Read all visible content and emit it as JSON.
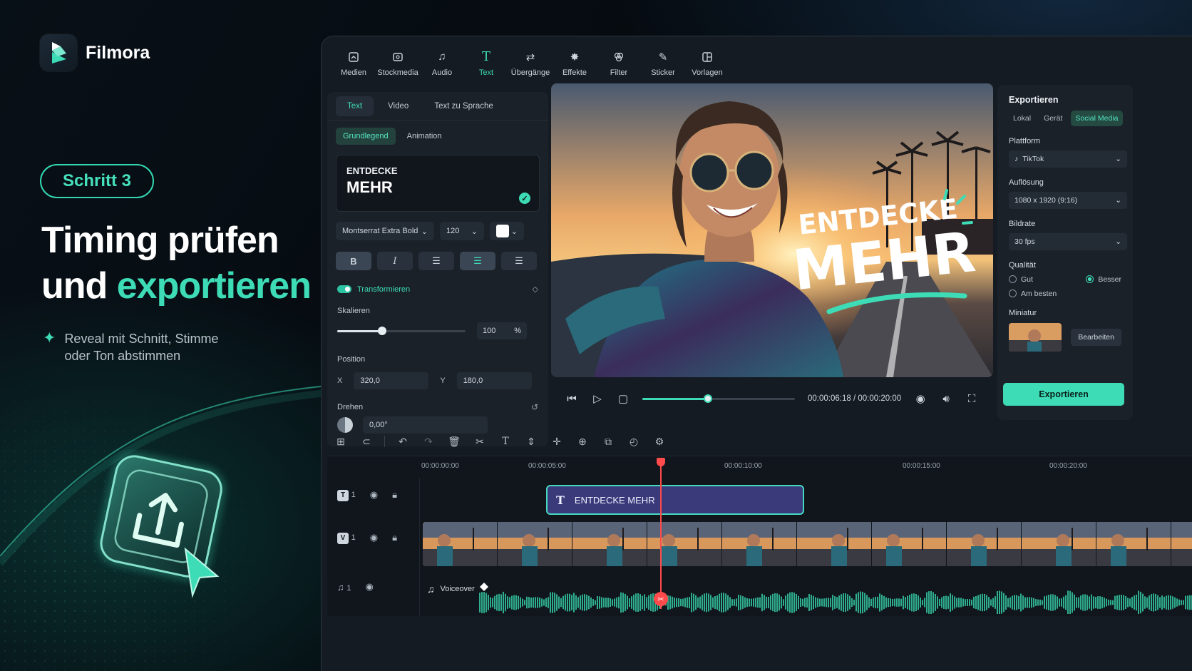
{
  "brand": {
    "name": "Filmora"
  },
  "step_badge": "Schritt 3",
  "headline": {
    "line1": "Timing prüfen",
    "line2_pre": "und ",
    "line2_accent": "exportieren"
  },
  "subtext": {
    "line1": "Reveal mit Schnitt, Stimme",
    "line2": "oder Ton abstimmen"
  },
  "toolbar": {
    "items": [
      {
        "label": "Medien",
        "icon": "media-icon"
      },
      {
        "label": "Stockmedia",
        "icon": "stock-media-icon"
      },
      {
        "label": "Audio",
        "icon": "music-note-icon"
      },
      {
        "label": "Text",
        "icon": "text-icon",
        "active": true
      },
      {
        "label": "Übergänge",
        "icon": "transitions-icon"
      },
      {
        "label": "Effekte",
        "icon": "effects-icon"
      },
      {
        "label": "Filter",
        "icon": "filter-icon"
      },
      {
        "label": "Sticker",
        "icon": "sticker-icon"
      },
      {
        "label": "Vorlagen",
        "icon": "templates-icon"
      }
    ]
  },
  "text_panel": {
    "tabs": [
      "Text",
      "Video",
      "Text zu Sprache"
    ],
    "subtabs": [
      "Grundlegend",
      "Animation"
    ],
    "content_line1": "ENTDECKE",
    "content_line2": "MEHR",
    "font": "Montserrat Extra Bold",
    "size": "120",
    "color": "#ffffff",
    "transform_label": "Transformieren",
    "scale_label": "Skalieren",
    "scale_value": "100",
    "scale_unit": "%",
    "scale_fraction": 0.35,
    "position_label": "Position",
    "x_label": "X",
    "x_value": "320,0",
    "y_label": "Y",
    "y_value": "180,0",
    "rotate_label": "Drehen",
    "rotate_value": "0,00°"
  },
  "preview": {
    "overlay_line1": "ENTDECKE",
    "overlay_line2": "MEHR",
    "progress_fraction": 0.43,
    "current_time": "00:00:06:18",
    "separator": "/",
    "total_time": "00:00:20:00"
  },
  "export_panel": {
    "title": "Exportieren",
    "tabs": [
      "Lokal",
      "Gerät",
      "Social Media"
    ],
    "platform_label": "Plattform",
    "platform_value": "TikTok",
    "resolution_label": "Auflösung",
    "resolution_value": "1080 x 1920 (9:16)",
    "framerate_label": "Bildrate",
    "framerate_value": "30 fps",
    "quality_label": "Qualität",
    "quality_options": [
      "Gut",
      "Besser",
      "Am besten"
    ],
    "quality_selected": "Besser",
    "thumbnail_label": "Miniatur",
    "edit_label": "Bearbeiten",
    "export_button": "Exportieren"
  },
  "timeline": {
    "ticks": [
      "00:00:00:00",
      "00:00:05:00",
      "00:00:10:00",
      "00:00:15:00",
      "00:00:20:00"
    ],
    "tracks": [
      {
        "badge": "T",
        "index": "1"
      },
      {
        "badge": "V",
        "index": "1"
      },
      {
        "badge": "♫",
        "index": "1"
      }
    ],
    "text_clip_label": "ENTDECKE MEHR",
    "audio_clip_label": "Voiceover"
  },
  "colors": {
    "accent": "#3ddcb6",
    "playhead": "#ff4b4b",
    "clip_text": "#3a3a7a"
  }
}
